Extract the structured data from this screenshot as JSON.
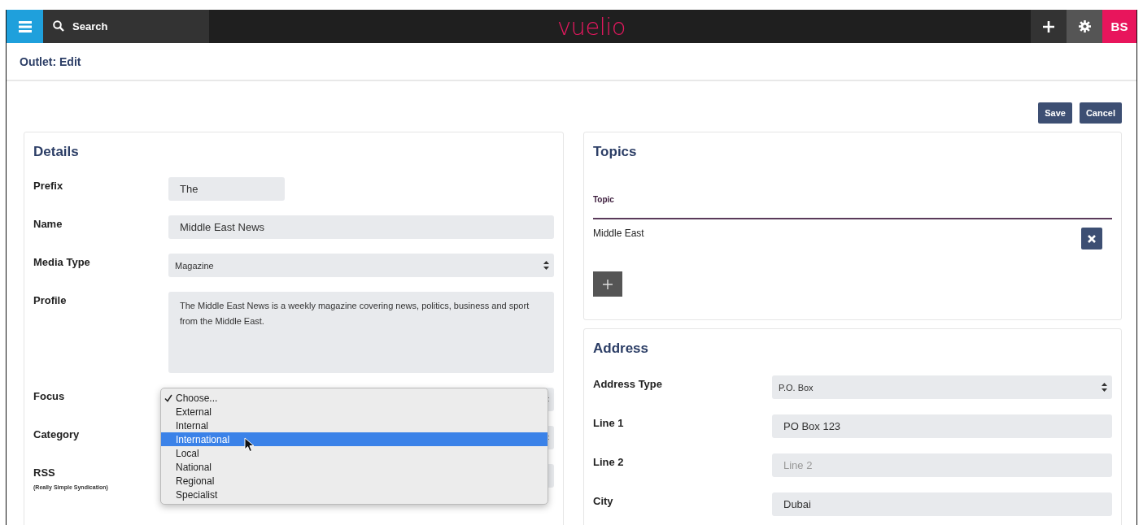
{
  "topbar": {
    "search": {
      "placeholder": "Search"
    },
    "logo": "vuelio",
    "avatar": "BS"
  },
  "header": {
    "title": "Outlet: Edit"
  },
  "actions": [
    "Save",
    "Cancel"
  ],
  "details": {
    "title": "Details",
    "fields": [
      {
        "kind": "short-input",
        "label": "Prefix",
        "value": "The"
      },
      {
        "kind": "input",
        "label": "Name",
        "value": "Middle East News"
      },
      {
        "kind": "select",
        "label": "Media Type",
        "value": "Magazine"
      },
      {
        "kind": "textarea",
        "label": "Profile",
        "value": "The Middle East News is a weekly magazine covering news, politics, business and sport from the Middle East."
      },
      {
        "kind": "select",
        "label": "Focus",
        "open": true,
        "options": [
          {
            "label": "Choose...",
            "checked": true,
            "selected": false
          },
          {
            "label": "External",
            "checked": false,
            "selected": false
          },
          {
            "label": "Internal",
            "checked": false,
            "selected": false
          },
          {
            "label": "International",
            "checked": false,
            "selected": true
          },
          {
            "label": "Local",
            "checked": false,
            "selected": false
          },
          {
            "label": "National",
            "checked": false,
            "selected": false
          },
          {
            "label": "Regional",
            "checked": false,
            "selected": false
          },
          {
            "label": "Specialist",
            "checked": false,
            "selected": false
          }
        ]
      },
      {
        "kind": "select",
        "label": "Category"
      },
      {
        "kind": "input",
        "label": "RSS",
        "sublabel": "(Really Simple Syndication)"
      }
    ]
  },
  "topics": {
    "title": "Topics",
    "column": "Topic",
    "rows": [
      "Middle East"
    ]
  },
  "address": {
    "title": "Address",
    "fields": [
      {
        "kind": "select",
        "label": "Address Type",
        "value": "P.O. Box"
      },
      {
        "kind": "input",
        "label": "Line 1",
        "value": "PO Box 123"
      },
      {
        "kind": "input",
        "label": "Line 2",
        "placeholder": "Line 2"
      },
      {
        "kind": "input",
        "label": "City",
        "value": "Dubai"
      }
    ]
  }
}
